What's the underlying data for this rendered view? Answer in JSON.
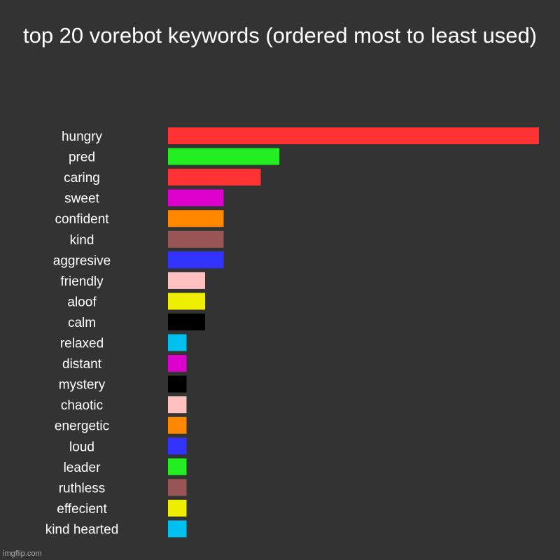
{
  "chart_data": {
    "type": "bar",
    "orientation": "horizontal",
    "title": "top 20 vorebot keywords (ordered most to least used)",
    "xlabel": "",
    "ylabel": "",
    "grid": false,
    "legend": "none",
    "xlim": [
      0,
      20
    ],
    "categories": [
      "hungry",
      "pred",
      "caring",
      "sweet",
      "confident",
      "kind",
      "aggresive",
      "friendly",
      "aloof",
      "calm",
      "relaxed",
      "distant",
      "mystery",
      "chaotic",
      "energetic",
      "loud",
      "leader",
      "ruthless",
      "effecient",
      "kind hearted"
    ],
    "values": [
      20,
      6,
      5,
      3,
      3,
      3,
      3,
      2,
      2,
      2,
      1,
      1,
      1,
      1,
      1,
      1,
      1,
      1,
      1,
      1
    ],
    "colors": [
      "#ff3333",
      "#22ee22",
      "#ff3333",
      "#dd00cc",
      "#ff8800",
      "#995555",
      "#3333ff",
      "#ffc0c0",
      "#eeee00",
      "#000000",
      "#00c0f0",
      "#dd00cc",
      "#000000",
      "#ffc0c0",
      "#ff8800",
      "#3333ff",
      "#22ee22",
      "#995555",
      "#eeee00",
      "#00c0f0"
    ]
  },
  "background_color": "#333333",
  "watermark": "imgflip.com"
}
